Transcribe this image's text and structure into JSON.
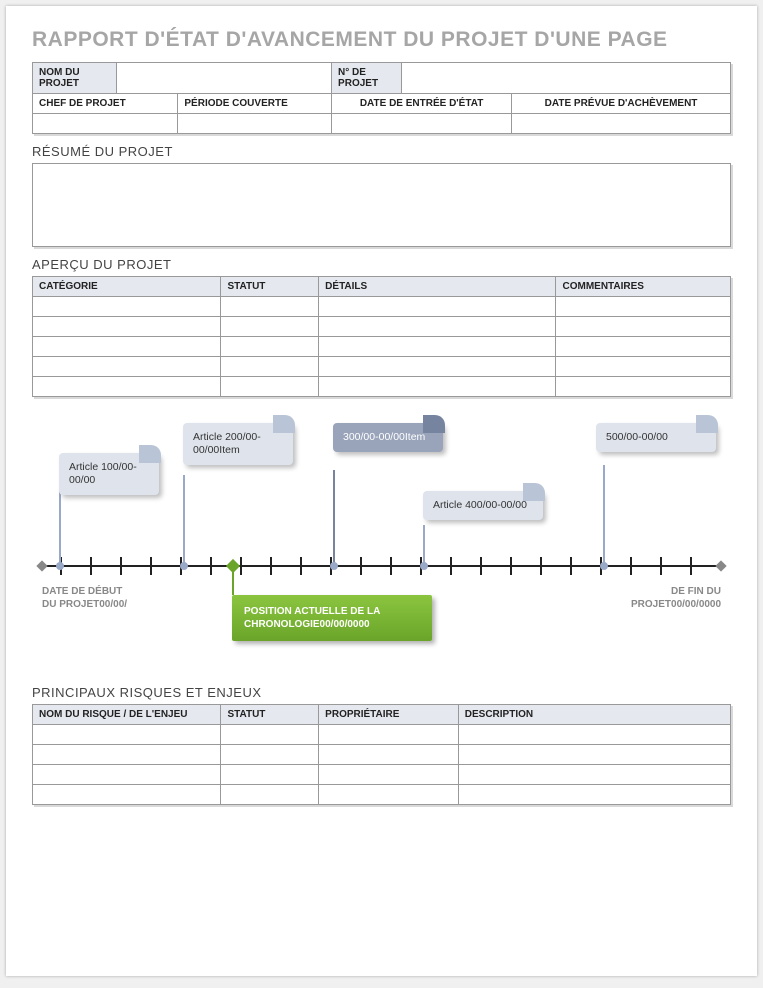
{
  "title": "RAPPORT D'ÉTAT D'AVANCEMENT DU PROJET D'UNE PAGE",
  "header_table": {
    "project_name_label": "NOM DU PROJET",
    "project_name_value": "",
    "project_no_label": "N° DE PROJET",
    "project_no_value": "",
    "manager_label": "CHEF DE PROJET",
    "manager_value": "",
    "period_label": "PÉRIODE COUVERTE",
    "period_value": "",
    "status_date_label": "DATE DE ENTRÉE D'ÉTAT",
    "status_date_value": "",
    "completion_date_label": "DATE PRÉVUE D'ACHÈVEMENT",
    "completion_date_value": ""
  },
  "summary": {
    "title": "RÉSUMÉ DU PROJET"
  },
  "overview": {
    "title": "APERÇU DU PROJET",
    "headers": {
      "category": "CATÉGORIE",
      "status": "STATUT",
      "details": "DÉTAILS",
      "comments": "COMMENTAIRES"
    }
  },
  "timeline": {
    "start_label": "DATE DE DÉBUT DU PROJET00/00/",
    "end_label": "DE FIN DU PROJET00/00/0000",
    "position_label": "POSITION ACTUELLE DE LA CHRONOLOGIE00/00/0000",
    "items": [
      {
        "label": "Article 100/00-00/00"
      },
      {
        "label": "Article 200/00-00/00Item"
      },
      {
        "label": "300/00-00/00Item"
      },
      {
        "label": "Article 400/00-00/00"
      },
      {
        "label": "500/00-00/00"
      }
    ]
  },
  "risks": {
    "title": "PRINCIPAUX RISQUES ET ENJEUX",
    "headers": {
      "name": "NOM DU RISQUE / DE L'ENJEU",
      "status": "STATUT",
      "owner": "PROPRIÉTAIRE",
      "description": "DESCRIPTION"
    }
  }
}
